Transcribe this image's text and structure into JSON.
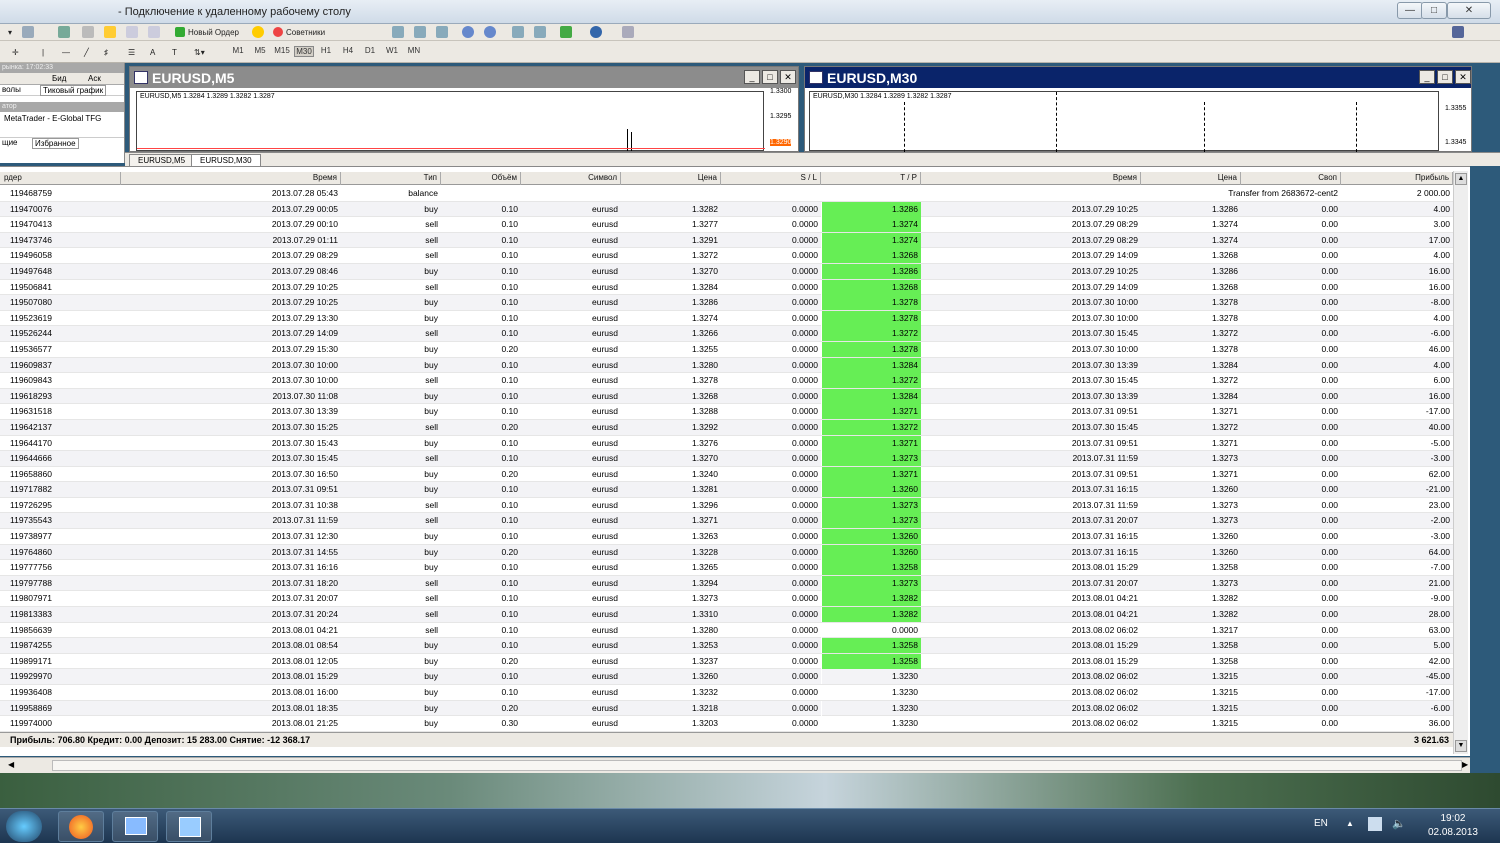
{
  "window": {
    "title": "- Подключение к удаленному рабочему столу"
  },
  "toolbar": {
    "new_order": "Новый Ордер",
    "advisors": "Советники",
    "timeframes": [
      "M1",
      "M5",
      "M15",
      "M30",
      "H1",
      "H4",
      "D1",
      "W1",
      "MN"
    ],
    "active_timeframe": "M30"
  },
  "market_watch": {
    "header": "рынка: 17:02:33",
    "col_bid": "Бид",
    "col_ask": "Аск",
    "tabs": [
      "волы",
      "Тиковый график"
    ]
  },
  "navigator": {
    "header": "атор",
    "item": "MetaTrader - E-Global TFG",
    "tabs": [
      "щие",
      "Избранное"
    ]
  },
  "charts": [
    {
      "title": "EURUSD,M5",
      "info": "EURUSD,M5  1.3284 1.3289 1.3282 1.3287",
      "prices": [
        "1.3300",
        "1.3295",
        "1.3290"
      ]
    },
    {
      "title": "EURUSD,M30",
      "info": "EURUSD,M30  1.3284 1.3289 1.3282 1.3287",
      "prices": [
        "1.3355",
        "1.3345"
      ]
    }
  ],
  "chart_tabs": [
    "EURUSD,M5",
    "EURUSD,M30"
  ],
  "table": {
    "columns": [
      "рдер",
      "Время",
      "Тип",
      "Объём",
      "Символ",
      "Цена",
      "S / L",
      "T / P",
      "Время",
      "Цена",
      "Своп",
      "Прибыль"
    ],
    "balance_row": {
      "order": "119468759",
      "time": "2013.07.28 05:43",
      "type": "balance",
      "comment": "Transfer from 2683672-cent2",
      "profit": "2 000.00"
    },
    "rows": [
      [
        "119470076",
        "2013.07.29 00:05",
        "buy",
        "0.10",
        "eurusd",
        "1.3282",
        "0.0000",
        "1.3286",
        "2013.07.29 10:25",
        "1.3286",
        "0.00",
        "4.00",
        true
      ],
      [
        "119470413",
        "2013.07.29 00:10",
        "sell",
        "0.10",
        "eurusd",
        "1.3277",
        "0.0000",
        "1.3274",
        "2013.07.29 08:29",
        "1.3274",
        "0.00",
        "3.00",
        true
      ],
      [
        "119473746",
        "2013.07.29 01:11",
        "sell",
        "0.10",
        "eurusd",
        "1.3291",
        "0.0000",
        "1.3274",
        "2013.07.29 08:29",
        "1.3274",
        "0.00",
        "17.00",
        true
      ],
      [
        "119496058",
        "2013.07.29 08:29",
        "sell",
        "0.10",
        "eurusd",
        "1.3272",
        "0.0000",
        "1.3268",
        "2013.07.29 14:09",
        "1.3268",
        "0.00",
        "4.00",
        true
      ],
      [
        "119497648",
        "2013.07.29 08:46",
        "buy",
        "0.10",
        "eurusd",
        "1.3270",
        "0.0000",
        "1.3286",
        "2013.07.29 10:25",
        "1.3286",
        "0.00",
        "16.00",
        true
      ],
      [
        "119506841",
        "2013.07.29 10:25",
        "sell",
        "0.10",
        "eurusd",
        "1.3284",
        "0.0000",
        "1.3268",
        "2013.07.29 14:09",
        "1.3268",
        "0.00",
        "16.00",
        true
      ],
      [
        "119507080",
        "2013.07.29 10:25",
        "buy",
        "0.10",
        "eurusd",
        "1.3286",
        "0.0000",
        "1.3278",
        "2013.07.30 10:00",
        "1.3278",
        "0.00",
        "-8.00",
        true
      ],
      [
        "119523619",
        "2013.07.29 13:30",
        "buy",
        "0.10",
        "eurusd",
        "1.3274",
        "0.0000",
        "1.3278",
        "2013.07.30 10:00",
        "1.3278",
        "0.00",
        "4.00",
        true
      ],
      [
        "119526244",
        "2013.07.29 14:09",
        "sell",
        "0.10",
        "eurusd",
        "1.3266",
        "0.0000",
        "1.3272",
        "2013.07.30 15:45",
        "1.3272",
        "0.00",
        "-6.00",
        true
      ],
      [
        "119536577",
        "2013.07.29 15:30",
        "buy",
        "0.20",
        "eurusd",
        "1.3255",
        "0.0000",
        "1.3278",
        "2013.07.30 10:00",
        "1.3278",
        "0.00",
        "46.00",
        true
      ],
      [
        "119609837",
        "2013.07.30 10:00",
        "buy",
        "0.10",
        "eurusd",
        "1.3280",
        "0.0000",
        "1.3284",
        "2013.07.30 13:39",
        "1.3284",
        "0.00",
        "4.00",
        true
      ],
      [
        "119609843",
        "2013.07.30 10:00",
        "sell",
        "0.10",
        "eurusd",
        "1.3278",
        "0.0000",
        "1.3272",
        "2013.07.30 15:45",
        "1.3272",
        "0.00",
        "6.00",
        true
      ],
      [
        "119618293",
        "2013.07.30 11:08",
        "buy",
        "0.10",
        "eurusd",
        "1.3268",
        "0.0000",
        "1.3284",
        "2013.07.30 13:39",
        "1.3284",
        "0.00",
        "16.00",
        true
      ],
      [
        "119631518",
        "2013.07.30 13:39",
        "buy",
        "0.10",
        "eurusd",
        "1.3288",
        "0.0000",
        "1.3271",
        "2013.07.31 09:51",
        "1.3271",
        "0.00",
        "-17.00",
        true
      ],
      [
        "119642137",
        "2013.07.30 15:25",
        "sell",
        "0.20",
        "eurusd",
        "1.3292",
        "0.0000",
        "1.3272",
        "2013.07.30 15:45",
        "1.3272",
        "0.00",
        "40.00",
        true
      ],
      [
        "119644170",
        "2013.07.30 15:43",
        "buy",
        "0.10",
        "eurusd",
        "1.3276",
        "0.0000",
        "1.3271",
        "2013.07.31 09:51",
        "1.3271",
        "0.00",
        "-5.00",
        true
      ],
      [
        "119644666",
        "2013.07.30 15:45",
        "sell",
        "0.10",
        "eurusd",
        "1.3270",
        "0.0000",
        "1.3273",
        "2013.07.31 11:59",
        "1.3273",
        "0.00",
        "-3.00",
        true
      ],
      [
        "119658860",
        "2013.07.30 16:50",
        "buy",
        "0.20",
        "eurusd",
        "1.3240",
        "0.0000",
        "1.3271",
        "2013.07.31 09:51",
        "1.3271",
        "0.00",
        "62.00",
        true
      ],
      [
        "119717882",
        "2013.07.31 09:51",
        "buy",
        "0.10",
        "eurusd",
        "1.3281",
        "0.0000",
        "1.3260",
        "2013.07.31 16:15",
        "1.3260",
        "0.00",
        "-21.00",
        true
      ],
      [
        "119726295",
        "2013.07.31 10:38",
        "sell",
        "0.10",
        "eurusd",
        "1.3296",
        "0.0000",
        "1.3273",
        "2013.07.31 11:59",
        "1.3273",
        "0.00",
        "23.00",
        true
      ],
      [
        "119735543",
        "2013.07.31 11:59",
        "sell",
        "0.10",
        "eurusd",
        "1.3271",
        "0.0000",
        "1.3273",
        "2013.07.31 20:07",
        "1.3273",
        "0.00",
        "-2.00",
        true
      ],
      [
        "119738977",
        "2013.07.31 12:30",
        "buy",
        "0.10",
        "eurusd",
        "1.3263",
        "0.0000",
        "1.3260",
        "2013.07.31 16:15",
        "1.3260",
        "0.00",
        "-3.00",
        true
      ],
      [
        "119764860",
        "2013.07.31 14:55",
        "buy",
        "0.20",
        "eurusd",
        "1.3228",
        "0.0000",
        "1.3260",
        "2013.07.31 16:15",
        "1.3260",
        "0.00",
        "64.00",
        true
      ],
      [
        "119777756",
        "2013.07.31 16:16",
        "buy",
        "0.10",
        "eurusd",
        "1.3265",
        "0.0000",
        "1.3258",
        "2013.08.01 15:29",
        "1.3258",
        "0.00",
        "-7.00",
        true
      ],
      [
        "119797788",
        "2013.07.31 18:20",
        "sell",
        "0.10",
        "eurusd",
        "1.3294",
        "0.0000",
        "1.3273",
        "2013.07.31 20:07",
        "1.3273",
        "0.00",
        "21.00",
        true
      ],
      [
        "119807971",
        "2013.07.31 20:07",
        "sell",
        "0.10",
        "eurusd",
        "1.3273",
        "0.0000",
        "1.3282",
        "2013.08.01 04:21",
        "1.3282",
        "0.00",
        "-9.00",
        true
      ],
      [
        "119813383",
        "2013.07.31 20:24",
        "sell",
        "0.10",
        "eurusd",
        "1.3310",
        "0.0000",
        "1.3282",
        "2013.08.01 04:21",
        "1.3282",
        "0.00",
        "28.00",
        true
      ],
      [
        "119856639",
        "2013.08.01 04:21",
        "sell",
        "0.10",
        "eurusd",
        "1.3280",
        "0.0000",
        "0.0000",
        "2013.08.02 06:02",
        "1.3217",
        "0.00",
        "63.00",
        false
      ],
      [
        "119874255",
        "2013.08.01 08:54",
        "buy",
        "0.10",
        "eurusd",
        "1.3253",
        "0.0000",
        "1.3258",
        "2013.08.01 15:29",
        "1.3258",
        "0.00",
        "5.00",
        true
      ],
      [
        "119899171",
        "2013.08.01 12:05",
        "buy",
        "0.20",
        "eurusd",
        "1.3237",
        "0.0000",
        "1.3258",
        "2013.08.01 15:29",
        "1.3258",
        "0.00",
        "42.00",
        true
      ],
      [
        "119929970",
        "2013.08.01 15:29",
        "buy",
        "0.10",
        "eurusd",
        "1.3260",
        "0.0000",
        "1.3230",
        "2013.08.02 06:02",
        "1.3215",
        "0.00",
        "-45.00",
        false
      ],
      [
        "119936408",
        "2013.08.01 16:00",
        "buy",
        "0.10",
        "eurusd",
        "1.3232",
        "0.0000",
        "1.3230",
        "2013.08.02 06:02",
        "1.3215",
        "0.00",
        "-17.00",
        false
      ],
      [
        "119958869",
        "2013.08.01 18:35",
        "buy",
        "0.20",
        "eurusd",
        "1.3218",
        "0.0000",
        "1.3230",
        "2013.08.02 06:02",
        "1.3215",
        "0.00",
        "-6.00",
        false
      ],
      [
        "119974000",
        "2013.08.01 21:25",
        "buy",
        "0.30",
        "eurusd",
        "1.3203",
        "0.0000",
        "1.3230",
        "2013.08.02 06:02",
        "1.3215",
        "0.00",
        "36.00",
        false
      ]
    ],
    "summary": "Прибыль: 706.80  Кредит: 0.00  Депозит: 15 283.00  Снятие: -12 368.17",
    "summary_profit": "3 621.63"
  },
  "taskbar": {
    "lang": "EN",
    "time": "19:02",
    "date": "02.08.2013"
  },
  "colors": {
    "tp_hit": "#66ee55",
    "active_title": "#0a246a",
    "inactive_title": "#808080"
  }
}
